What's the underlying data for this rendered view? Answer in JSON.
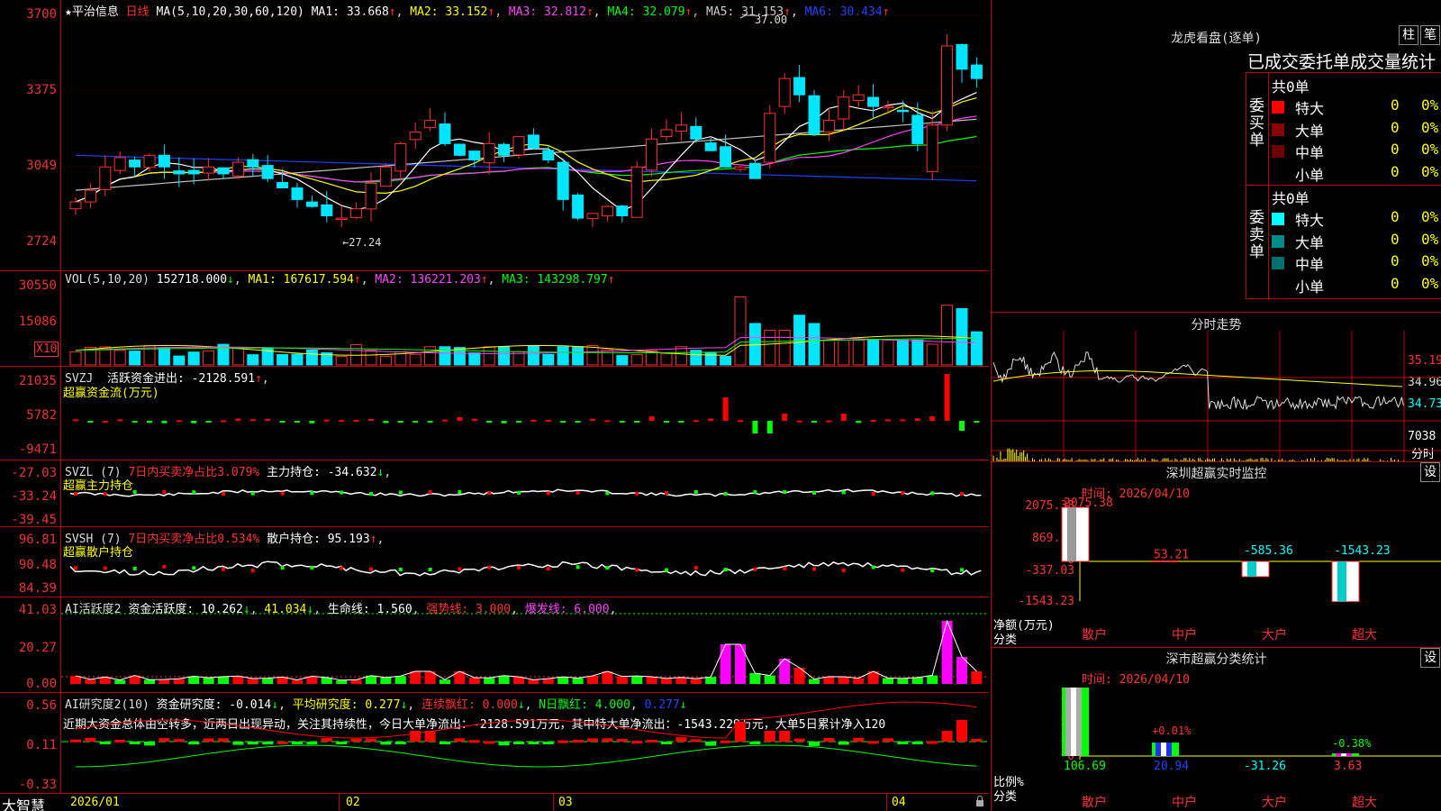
{
  "app": {
    "brand": "大智慧"
  },
  "kline": {
    "title": "★平治信息",
    "period": "日线",
    "ma_label": "MA(5,10,20,30,60,120)",
    "ma1": "MA1: 33.668",
    "ma2": "MA2: 33.152",
    "ma3": "MA3: 32.812",
    "ma4": "MA4: 32.079",
    "ma5": "MA5: 31.153",
    "ma6": "MA6: 30.434",
    "high_label": "37.00",
    "low_label": "←27.24",
    "yticks": [
      "3700",
      "3375",
      "3049",
      "2724"
    ],
    "colors": {
      "up": "#ff3030",
      "down": "#00e5ff",
      "ma1": "#ffffff",
      "ma2": "#ffff00",
      "ma3": "#ff40ff",
      "ma4": "#00ff00",
      "ma5": "#c0c0c0",
      "ma6": "#2040ff"
    }
  },
  "vol": {
    "label": "VOL(5,10,20)",
    "value": "152718.000",
    "ma1": "MA1: 167617.594",
    "ma2": "MA2: 136221.203",
    "ma3": "MA3: 143298.797",
    "yticks": [
      "30550",
      "15086"
    ],
    "unit": "X10"
  },
  "svzj": {
    "label": "SVZJ",
    "text": "活跃资金进出: -2128.591",
    "sub": "超赢资金流(万元)",
    "yticks": [
      "21035",
      "5782",
      "-9471"
    ]
  },
  "svzl": {
    "label": "SVZL (7)",
    "pct": "7日内买卖净占比3.079%",
    "hold": "主力持仓: -34.632",
    "sub": "超赢主力持仓",
    "yticks": [
      "-27.03",
      "-33.24",
      "-39.45"
    ]
  },
  "svsh": {
    "label": "SVSH (7)",
    "pct": "7日内买卖净占比0.534%",
    "hold": "散户持仓: 95.193",
    "sub": "超赢散户持仓",
    "yticks": [
      "96.81",
      "90.48",
      "84.39"
    ]
  },
  "ai1": {
    "label": "AI活跃度2",
    "act": "资金活跃度: 10.262",
    "v2": "41.034",
    "life": "生命线: 1.560",
    "strong": "强势线: 3.000",
    "burst": "爆发线: 6.000",
    "yticks": [
      "41.03",
      "20.27",
      "0.00"
    ]
  },
  "ai2": {
    "label": "AI研究度2(10)",
    "res": "资金研究度: -0.014",
    "avg": "平均研究度: 0.277",
    "lxpiao": "连续飘红: 0.000",
    "npiao": "N日飘红: 4.000",
    "v5": "0.277",
    "comment": "近期大资金总体由空转多，近两日出现异动，关注其持续性，今日大单净流出：-2128.591万元，其中特大单净流出：-1543.229万元，大单5日累计净入120",
    "yticks": [
      "0.56",
      "0.11",
      "-0.33"
    ]
  },
  "xaxis": [
    "2026/01",
    "02",
    "03",
    "04"
  ],
  "lhb": {
    "title": "龙虎看盘(逐单)",
    "btn1": "柱",
    "btn2": "笔",
    "head": "已成交委托单成交量统计",
    "buy": {
      "side": "委买单",
      "total": "共0单",
      "rows": [
        {
          "name": "特大",
          "v": "0",
          "p": "0%",
          "color": "#ff0000"
        },
        {
          "name": "大单",
          "v": "0",
          "p": "0%",
          "color": "#8b0000"
        },
        {
          "name": "中单",
          "v": "0",
          "p": "0%",
          "color": "#6a0000"
        },
        {
          "name": "小单",
          "v": "0",
          "p": "0%",
          "color": "#000000"
        }
      ]
    },
    "sell": {
      "side": "委卖单",
      "total": "共0单",
      "rows": [
        {
          "name": "特大",
          "v": "0",
          "p": "0%",
          "color": "#00ffff"
        },
        {
          "name": "大单",
          "v": "0",
          "p": "0%",
          "color": "#008b8b"
        },
        {
          "name": "中单",
          "v": "0",
          "p": "0%",
          "color": "#007070"
        },
        {
          "name": "小单",
          "v": "0",
          "p": "0%",
          "color": "#000000"
        }
      ]
    }
  },
  "intraday": {
    "title": "分时走势",
    "yticks": [
      "35.19",
      "34.96",
      "34.73"
    ],
    "vol": "7038",
    "unit": "分时"
  },
  "szmon": {
    "title": "深圳超赢实时监控",
    "btn": "设",
    "time": "时间: 2026/04/10",
    "yticks": [
      "2075.38",
      "869.18",
      "0",
      "-337.03",
      "-1543.23"
    ],
    "unitlabel": "净额(万元)",
    "cat": "分类",
    "cats": [
      "散户",
      "中户",
      "大户",
      "超大"
    ],
    "vals": [
      "2075.38",
      "53.21",
      "-585.36",
      "-1543.23"
    ]
  },
  "szcls": {
    "title": "深市超赢分类统计",
    "btn": "设",
    "time": "时间: 2026/04/10",
    "yticks": [
      "75",
      "50",
      "25",
      "0"
    ],
    "unitlabel": "比例%",
    "cat": "分类",
    "cats": [
      "散户",
      "中户",
      "大户",
      "超大"
    ],
    "vals": [
      "106.69",
      "20.94",
      "-31.26",
      "3.63"
    ],
    "notes": [
      "+0.01%",
      "-0.38%"
    ]
  }
}
